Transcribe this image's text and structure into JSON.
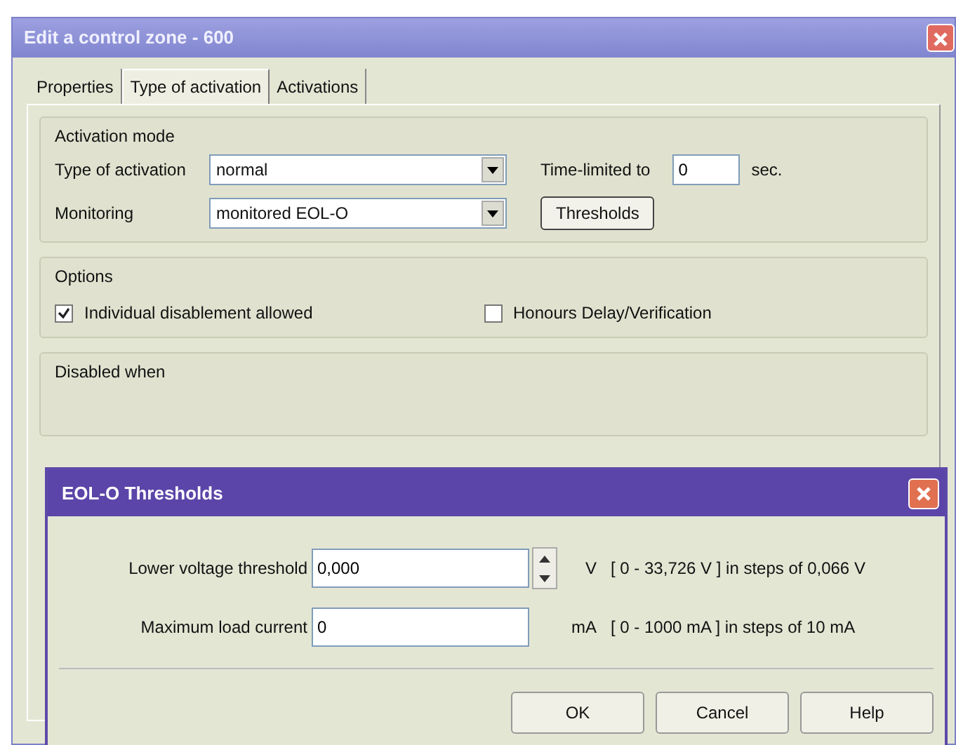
{
  "window": {
    "title": "Edit a control zone - 600"
  },
  "tabs": [
    {
      "label": "Properties",
      "selected": false
    },
    {
      "label": "Type of activation",
      "selected": true
    },
    {
      "label": "Activations",
      "selected": false
    }
  ],
  "activation_mode": {
    "title": "Activation mode",
    "type_label": "Type of activation",
    "type_value": "normal",
    "time_label": "Time-limited to",
    "time_value": "0",
    "time_unit": "sec.",
    "monitoring_label": "Monitoring",
    "monitoring_value": "monitored EOL-O",
    "thresholds_button": "Thresholds"
  },
  "options": {
    "title": "Options",
    "items": [
      {
        "label": "Individual disablement allowed",
        "checked": true
      },
      {
        "label": "Honours Delay/Verification",
        "checked": false
      }
    ]
  },
  "disabled_when": {
    "title": "Disabled when"
  },
  "dialog": {
    "title": "EOL-O Thresholds",
    "rows": [
      {
        "kind": "spin",
        "label": "Lower voltage threshold",
        "value": "0,000",
        "unit": "V",
        "range": "[ 0 - 33,726 V ] in steps of 0,066 V"
      },
      {
        "kind": "text",
        "label": "Maximum load current",
        "value": "0",
        "unit": "mA",
        "range": "[ 0 - 1000 mA ] in steps of 10 mA"
      }
    ],
    "buttons": [
      "OK",
      "Cancel",
      "Help"
    ]
  }
}
